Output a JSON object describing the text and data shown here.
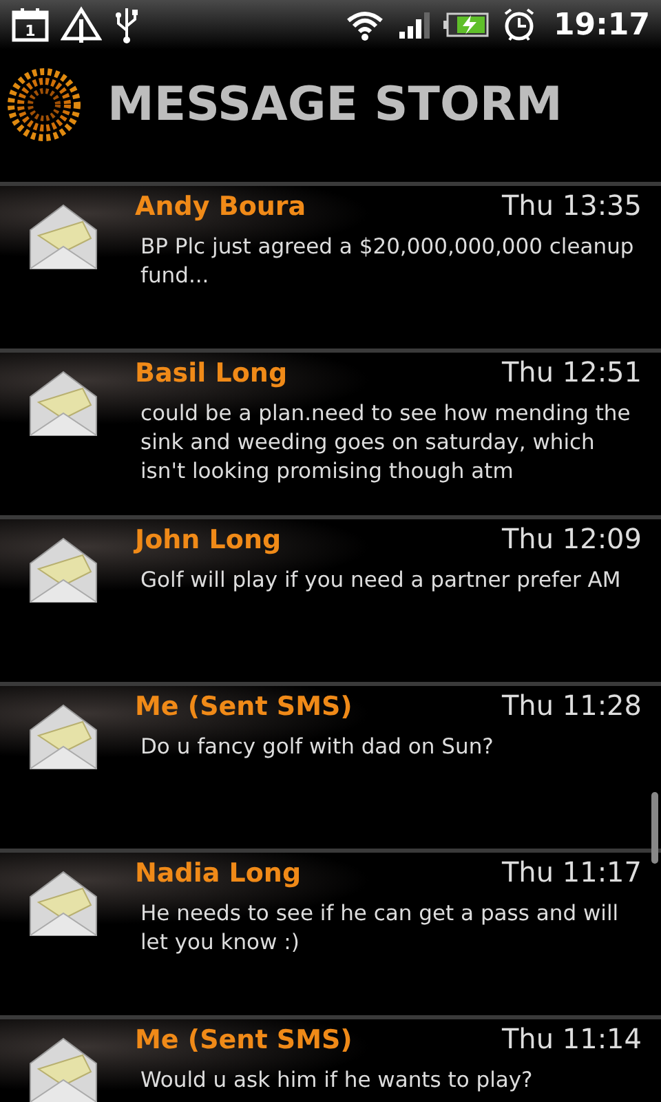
{
  "status_bar": {
    "calendar_day": "1",
    "time": "19:17"
  },
  "app_bar": {
    "title": "MESSAGE STORM"
  },
  "messages": [
    {
      "sender": "Andy Boura",
      "time": "Thu 13:35",
      "body": "BP Plc just agreed a $20,000,000,000 cleanup fund..."
    },
    {
      "sender": "Basil Long",
      "time": "Thu 12:51",
      "body": "could be a plan.need to see how mending the sink and weeding goes on saturday, which isn't looking promising though atm"
    },
    {
      "sender": "John Long",
      "time": "Thu 12:09",
      "body": "Golf will play if you need a partner prefer AM"
    },
    {
      "sender": "Me (Sent SMS)",
      "time": "Thu 11:28",
      "body": "Do u fancy golf with dad on Sun?"
    },
    {
      "sender": "Nadia Long",
      "time": "Thu 11:17",
      "body": "He needs to see if he can get a pass and will let you know :)"
    },
    {
      "sender": "Me (Sent SMS)",
      "time": "Thu 11:14",
      "body": "Would u ask him if he wants to play?"
    }
  ]
}
